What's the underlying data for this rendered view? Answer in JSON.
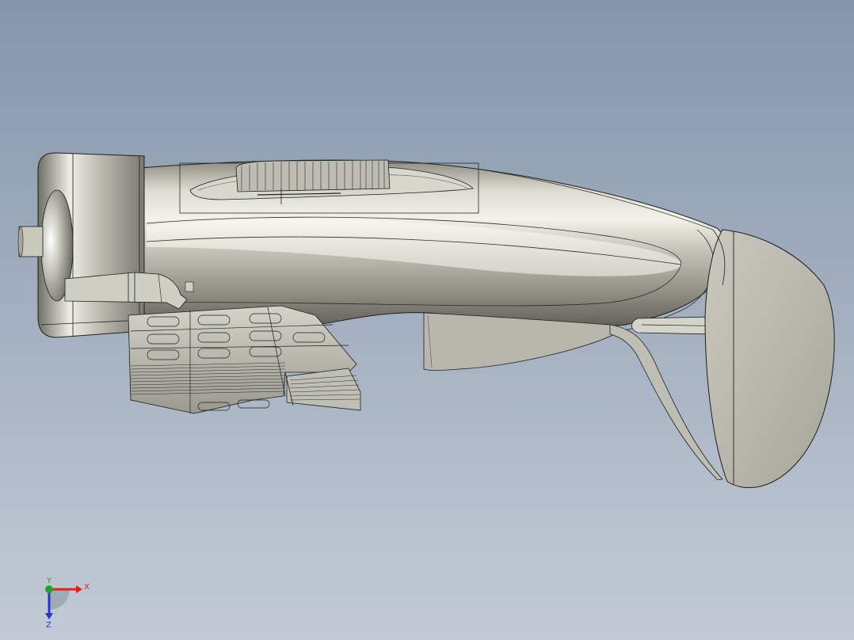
{
  "scene": {
    "background_top": "#8596ac",
    "background_bottom": "#c3cad6",
    "model_edge_color": "#1e1e1e"
  },
  "triad": {
    "x_label": "X",
    "y_label": "Y",
    "z_label": "Z",
    "x_color": "#e0201c",
    "y_color": "#2aa02a",
    "z_color": "#2438c8"
  }
}
